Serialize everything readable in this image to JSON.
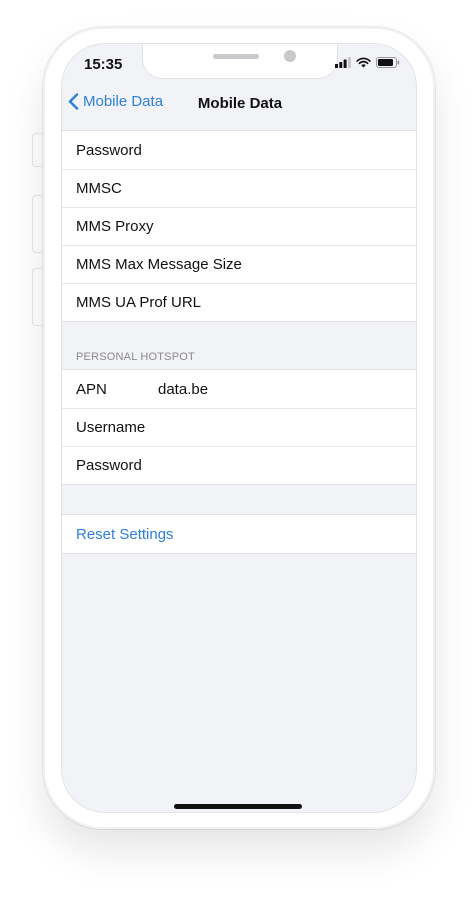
{
  "status_bar": {
    "time": "15:35"
  },
  "nav": {
    "back_label": "Mobile Data",
    "title": "Mobile Data"
  },
  "mms_group": {
    "rows": [
      {
        "label": "Password"
      },
      {
        "label": "MMSC"
      },
      {
        "label": "MMS Proxy"
      },
      {
        "label": "MMS Max Message Size"
      },
      {
        "label": "MMS UA Prof URL"
      }
    ]
  },
  "personal_hotspot": {
    "header": "PERSONAL HOTSPOT",
    "rows": [
      {
        "label": "APN",
        "value": "data.be"
      },
      {
        "label": "Username"
      },
      {
        "label": "Password"
      }
    ]
  },
  "reset": {
    "label": "Reset Settings"
  },
  "colors": {
    "accent": "#2d7fdb",
    "background": "#f2f3f6"
  }
}
